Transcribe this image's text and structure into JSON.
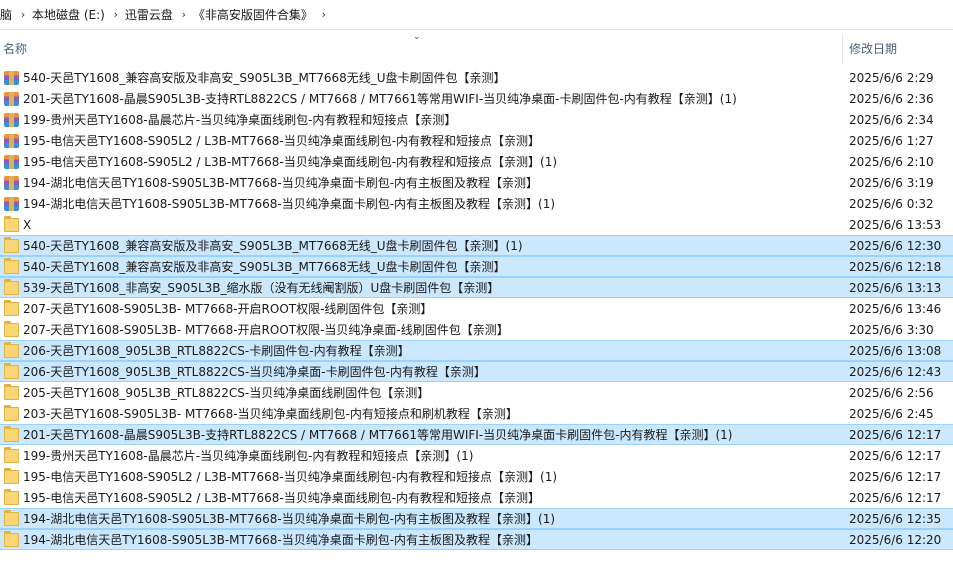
{
  "breadcrumb": [
    "脑",
    "本地磁盘 (E:)",
    "迅雷云盘",
    "《非高安版固件合集》"
  ],
  "columns": {
    "name": "名称",
    "modified": "修改日期"
  },
  "files": [
    {
      "name": "540-天邑TY1608_兼容高安版及非高安_S905L3B_MT7668无线_U盘卡刷固件包【亲测】",
      "date": "2025/6/6 2:29",
      "type": "archive",
      "selected": false
    },
    {
      "name": "201-天邑TY1608-晶晨S905L3B-支持RTL8822CS / MT7668 / MT7661等常用WIFI-当贝纯净桌面-卡刷固件包-内有教程【亲测】(1)",
      "date": "2025/6/6 2:36",
      "type": "archive",
      "selected": false
    },
    {
      "name": "199-贵州天邑TY1608-晶晨芯片-当贝纯净桌面线刷包-内有教程和短接点【亲测】",
      "date": "2025/6/6 2:34",
      "type": "archive",
      "selected": false
    },
    {
      "name": "195-电信天邑TY1608-S905L2 / L3B-MT7668-当贝纯净桌面线刷包-内有教程和短接点【亲测】",
      "date": "2025/6/6 1:27",
      "type": "archive",
      "selected": false
    },
    {
      "name": "195-电信天邑TY1608-S905L2 / L3B-MT7668-当贝纯净桌面线刷包-内有教程和短接点【亲测】(1)",
      "date": "2025/6/6 2:10",
      "type": "archive",
      "selected": false
    },
    {
      "name": "194-湖北电信天邑TY1608-S905L3B-MT7668-当贝纯净桌面卡刷包-内有主板图及教程【亲测】",
      "date": "2025/6/6 3:19",
      "type": "archive",
      "selected": false
    },
    {
      "name": "194-湖北电信天邑TY1608-S905L3B-MT7668-当贝纯净桌面卡刷包-内有主板图及教程【亲测】(1)",
      "date": "2025/6/6 0:32",
      "type": "archive",
      "selected": false
    },
    {
      "name": "X",
      "date": "2025/6/6 13:53",
      "type": "folder",
      "selected": false
    },
    {
      "name": "540-天邑TY1608_兼容高安版及非高安_S905L3B_MT7668无线_U盘卡刷固件包【亲测】(1)",
      "date": "2025/6/6 12:30",
      "type": "folder",
      "selected": true
    },
    {
      "name": "540-天邑TY1608_兼容高安版及非高安_S905L3B_MT7668无线_U盘卡刷固件包【亲测】",
      "date": "2025/6/6 12:18",
      "type": "folder",
      "selected": true
    },
    {
      "name": "539-天邑TY1608_非高安_S905L3B_缩水版（没有无线阉割版）U盘卡刷固件包【亲测】",
      "date": "2025/6/6 13:13",
      "type": "folder",
      "selected": true
    },
    {
      "name": "207-天邑TY1608-S905L3B- MT7668-开启ROOT权限-线刷固件包【亲测】",
      "date": "2025/6/6 13:46",
      "type": "folder",
      "selected": false
    },
    {
      "name": "207-天邑TY1608-S905L3B- MT7668-开启ROOT权限-当贝纯净桌面-线刷固件包【亲测】",
      "date": "2025/6/6 3:30",
      "type": "folder",
      "selected": false
    },
    {
      "name": "206-天邑TY1608_905L3B_RTL8822CS-卡刷固件包-内有教程【亲测】",
      "date": "2025/6/6 13:08",
      "type": "folder",
      "selected": true
    },
    {
      "name": "206-天邑TY1608_905L3B_RTL8822CS-当贝纯净桌面-卡刷固件包-内有教程【亲测】",
      "date": "2025/6/6 12:43",
      "type": "folder",
      "selected": true
    },
    {
      "name": "205-天邑TY1608_905L3B_RTL8822CS-当贝纯净桌面线刷固件包【亲测】",
      "date": "2025/6/6 2:56",
      "type": "folder",
      "selected": false
    },
    {
      "name": "203-天邑TY1608-S905L3B- MT7668-当贝纯净桌面线刷包-内有短接点和刷机教程【亲测】",
      "date": "2025/6/6 2:45",
      "type": "folder",
      "selected": false
    },
    {
      "name": "201-天邑TY1608-晶晨S905L3B-支持RTL8822CS / MT7668 / MT7661等常用WIFI-当贝纯净桌面卡刷固件包-内有教程【亲测】(1)",
      "date": "2025/6/6 12:17",
      "type": "folder",
      "selected": true
    },
    {
      "name": "199-贵州天邑TY1608-晶晨芯片-当贝纯净桌面线刷包-内有教程和短接点【亲测】(1)",
      "date": "2025/6/6 12:17",
      "type": "folder",
      "selected": false
    },
    {
      "name": "195-电信天邑TY1608-S905L2 / L3B-MT7668-当贝纯净桌面线刷包-内有教程和短接点【亲测】(1)",
      "date": "2025/6/6 12:17",
      "type": "folder",
      "selected": false
    },
    {
      "name": "195-电信天邑TY1608-S905L2 / L3B-MT7668-当贝纯净桌面线刷包-内有教程和短接点【亲测】",
      "date": "2025/6/6 12:17",
      "type": "folder",
      "selected": false
    },
    {
      "name": "194-湖北电信天邑TY1608-S905L3B-MT7668-当贝纯净桌面卡刷包-内有主板图及教程【亲测】(1)",
      "date": "2025/6/6 12:35",
      "type": "folder",
      "selected": true
    },
    {
      "name": "194-湖北电信天邑TY1608-S905L3B-MT7668-当贝纯净桌面卡刷包-内有主板图及教程【亲测】",
      "date": "2025/6/6 12:20",
      "type": "folder",
      "selected": true
    }
  ]
}
